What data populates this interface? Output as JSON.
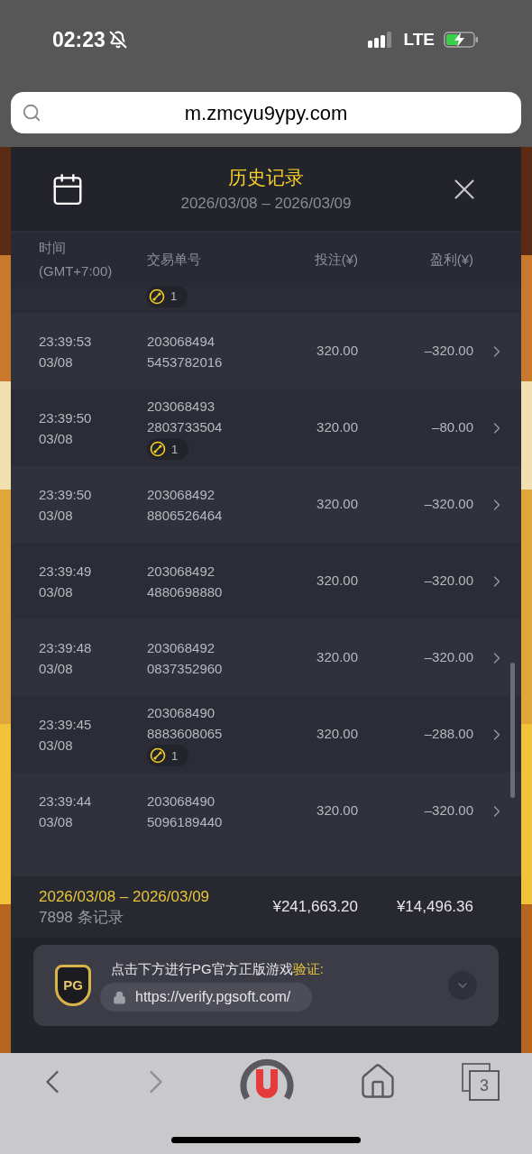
{
  "status_bar": {
    "time": "02:23",
    "network": "LTE"
  },
  "address_bar": {
    "url": "m.zmcyu9ypy.com"
  },
  "header": {
    "title": "历史记录",
    "date_range": "2026/03/08 – 2026/03/09"
  },
  "table": {
    "columns": [
      {
        "label": "时间",
        "sublabel": "(GMT+7:00)"
      },
      {
        "label": "交易单号"
      },
      {
        "label": "投注(¥)"
      },
      {
        "label": "盈利(¥)"
      }
    ],
    "rows": [
      {
        "kind": "partial",
        "badge": "1"
      },
      {
        "kind": "full",
        "time": "23:39:53",
        "date": "03/08",
        "id_line_1": "203068494",
        "id_line_2": "5453782016",
        "bet": "320.00",
        "profit": "–320.00"
      },
      {
        "kind": "full",
        "time": "23:39:50",
        "date": "03/08",
        "id_line_1": "203068493",
        "id_line_2": "2803733504",
        "badge": "1",
        "bet": "320.00",
        "profit": "–80.00"
      },
      {
        "kind": "full",
        "time": "23:39:50",
        "date": "03/08",
        "id_line_1": "203068492",
        "id_line_2": "8806526464",
        "bet": "320.00",
        "profit": "–320.00"
      },
      {
        "kind": "full",
        "time": "23:39:49",
        "date": "03/08",
        "id_line_1": "203068492",
        "id_line_2": "4880698880",
        "bet": "320.00",
        "profit": "–320.00"
      },
      {
        "kind": "full",
        "time": "23:39:48",
        "date": "03/08",
        "id_line_1": "203068492",
        "id_line_2": "0837352960",
        "bet": "320.00",
        "profit": "–320.00"
      },
      {
        "kind": "full",
        "time": "23:39:45",
        "date": "03/08",
        "id_line_1": "203068490",
        "id_line_2": "8883608065",
        "badge": "1",
        "bet": "320.00",
        "profit": "–288.00"
      },
      {
        "kind": "full",
        "time": "23:39:44",
        "date": "03/08",
        "id_line_1": "203068490",
        "id_line_2": "5096189440",
        "bet": "320.00",
        "profit": "–320.00"
      }
    ]
  },
  "summary": {
    "date_range": "2026/03/08 – 2026/03/09",
    "record_count": "7898 条记录",
    "total_bet": "¥241,663.20",
    "total_profit": "¥14,496.36"
  },
  "verification": {
    "logo": "PG",
    "text": "点击下方进行PG官方正版游戏",
    "highlight": "验证:",
    "url": "https://verify.pgsoft.com/"
  },
  "toolbar": {
    "tab_count": "3"
  }
}
